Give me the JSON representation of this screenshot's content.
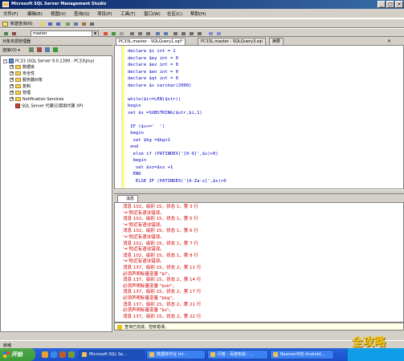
{
  "window": {
    "title": "Microsoft SQL Server Management Studio"
  },
  "menu": [
    "文件(F)",
    "编辑(E)",
    "视图(V)",
    "查询(Q)",
    "项目(P)",
    "工具(T)",
    "窗口(W)",
    "社区(C)",
    "帮助(H)"
  ],
  "toolbar": {
    "new_query_label": "新建查询(N)",
    "database_combo": "master"
  },
  "object_explorer": {
    "title": "对象资源管理器",
    "connect_label": "连接(O) ▾",
    "server_node": "PC33 (SQL Server 9.0.1399 - PC33\\jiny)",
    "nodes": [
      "数据库",
      "安全性",
      "服务器对象",
      "复制",
      "管理",
      "Notification Services"
    ],
    "agent_node": "SQL Server 代理(已禁用代理 XP)"
  },
  "tabs": [
    "PC33L.master - SQLQuery1.sql*",
    "PC33L.master - SQLQuery3.sql",
    "摘要"
  ],
  "code_lines": [
    "declare $i int = 1",
    "declare $ey int = 0",
    "declare $ez int = 0",
    "declare $en int = 0",
    "declare $qt int = 0",
    "declare $s varchar(2000)",
    "",
    "while($i<=LEN($str))",
    "begin",
    "set $s =SUBSTRING($str,$i,1)",
    "",
    " IF ($s<='  ')",
    " begin",
    "  set $kg =$kg+1",
    " end",
    "  else if (PATINDEX('[0-9]',$s)>0)",
    "  begin",
    "   set $sz=$sz +1",
    "  END",
    "   ELSE IF (PATINDEX('[A-Za-z]',$s)>0"
  ],
  "results": {
    "tab_label": "消息",
    "messages": [
      "消息 102，级别 15，状态 1，第 3 行",
      "'='附近有语法错误。",
      "消息 102，级别 15，状态 1，第 5 行",
      "'='附近有语法错误。",
      "消息 102，级别 15，状态 1，第 6 行",
      "'='附近有语法错误。",
      "消息 102，级别 15，状态 1，第 7 行",
      "'='附近有语法错误。",
      "消息 102，级别 15，状态 1，第 8 行",
      "'='附近有语法错误。",
      "消息 137，级别 15，状态 2，第 11 行",
      "必须声明标量变量 \"$i\"。",
      "消息 137，级别 15，状态 2，第 14 行",
      "必须声明标量变量 \"$str\"。",
      "消息 137，级别 15，状态 2，第 17 行",
      "必须声明标量变量 \"$kg\"。",
      "消息 137，级别 15，状态 2，第 21 行",
      "必须声明标量变量 \"$s\"。",
      "消息 137，级别 15，状态 2，第 22 行"
    ],
    "query_status": "查询已完成，但有错误。"
  },
  "statusbar": {
    "text": "就绪"
  },
  "taskbar": {
    "start_label": "开始",
    "tasks": [
      "Microsoft SQL Se...",
      "数据库作业 txt -",
      "问答 - 百度知道 - ...",
      "Beamer中的 Android..."
    ]
  },
  "watermark": "全攻略",
  "colors": {
    "title_bar": "#0a246a",
    "error_text": "#d40000",
    "taskbar": "#245edb",
    "start_button": "#3c9b36"
  }
}
